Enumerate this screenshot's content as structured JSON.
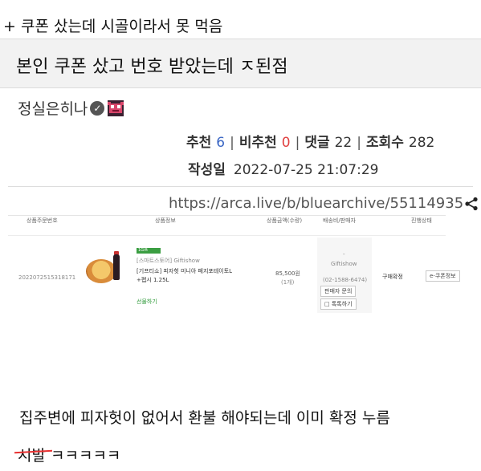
{
  "post": {
    "top_note": "+ 쿠폰 샀는데 시골이라서 못 먹음",
    "title": "본인 쿠폰 샀고 번호 받았는데 ㅈ된점",
    "author": "정실은히나",
    "stats": {
      "recommend_label": "추천",
      "recommend_value": "6",
      "not_recommend_label": "비추천",
      "not_recommend_value": "0",
      "comments_label": "댓글",
      "comments_value": "22",
      "views_label": "조회수",
      "views_value": "282",
      "separator": "|"
    },
    "date_label": "작성일",
    "date_value": "2022-07-25 21:07:29",
    "url": "https://arca.live/b/bluearchive/55114935",
    "body_line1": "집주변에 피자헛이 없어서 환불 해야되는데 이미 확정 누름",
    "body_line2_struck": "시발",
    "body_line2_rest": " ㅋㅋㅋㅋㅋ"
  },
  "order": {
    "headers": {
      "order_no": "상품주문번호",
      "product_info": "상품정보",
      "price_qty": "상품금액(수량)",
      "shipping_seller": "배송비/판매자",
      "status": "진행상태"
    },
    "row": {
      "order_number": "2022072515318171",
      "badge": "1Gift",
      "store": "[스마트스토어] Giftishow",
      "product_name_1": "[기프티쇼] 피자헛 미니아 페지포테이토L",
      "product_name_2": "+펩시 1.25L",
      "gift_label": "선물하기",
      "price": "85,500원",
      "qty": "(1개)",
      "dash": "-",
      "seller": "Giftishow",
      "seller_phone": "(02-1588-6474)",
      "contact_seller_button": "판매자 문의",
      "talk_button": "톡톡하기",
      "status": "구매확정",
      "coupon_info_button": "e-쿠폰정보"
    }
  },
  "icons": {
    "verified": "check-circle-icon",
    "avatar": "pixel-avatar-icon",
    "share": "share-icon"
  },
  "colors": {
    "recommend": "#3a66c4",
    "not_recommend": "#e04040",
    "strike": "#e83030"
  }
}
